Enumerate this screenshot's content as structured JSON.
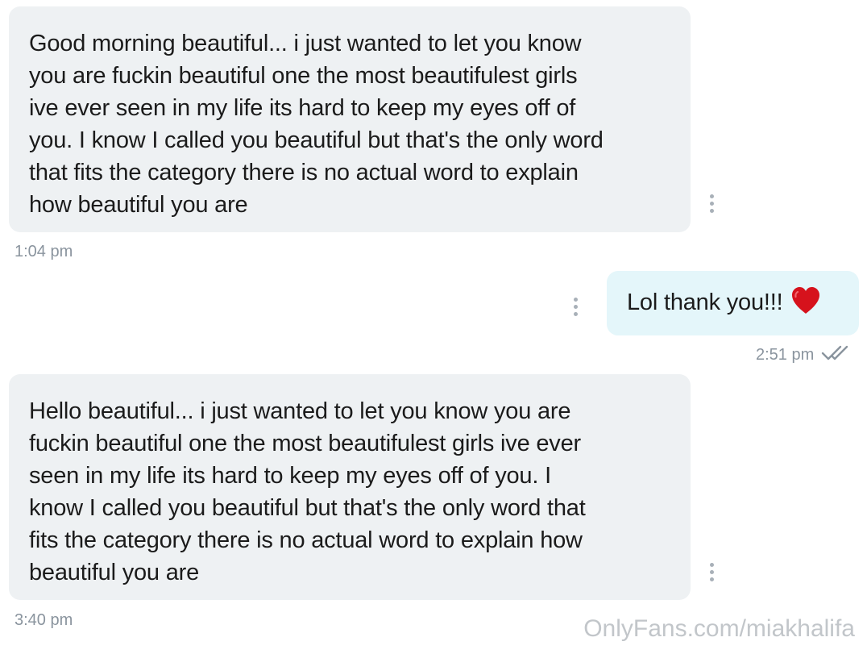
{
  "messages": [
    {
      "direction": "incoming",
      "text": "Good morning beautiful... i just wanted to let you know\nyou are fuckin beautiful one the most beautifulest girls\nive ever seen in my life its hard to keep my eyes off of\nyou. I know I called you beautiful but that's the only word\nthat fits the category there is no actual word to explain\nhow beautiful you are",
      "time": "1:04 pm"
    },
    {
      "direction": "outgoing",
      "text": "Lol thank you!!!",
      "emoji_icon": "red-heart-icon",
      "time": "2:51 pm",
      "status_icon": "double-check-icon"
    },
    {
      "direction": "incoming",
      "text": "Hello beautiful... i just wanted to let you know you are\nfuckin beautiful one the most beautifulest girls ive ever\nseen in my life its hard to keep my eyes off of you. I\nknow I called you beautiful but that's the only word that\nfits the category there is no actual word to explain how\nbeautiful you are",
      "time": "3:40 pm"
    }
  ],
  "watermark": "OnlyFans.com/miakhalifa",
  "colors": {
    "incoming_bubble": "#eef1f3",
    "outgoing_bubble": "#e4f6fa",
    "timestamp": "#8a949e",
    "heart": "#d6121c"
  }
}
